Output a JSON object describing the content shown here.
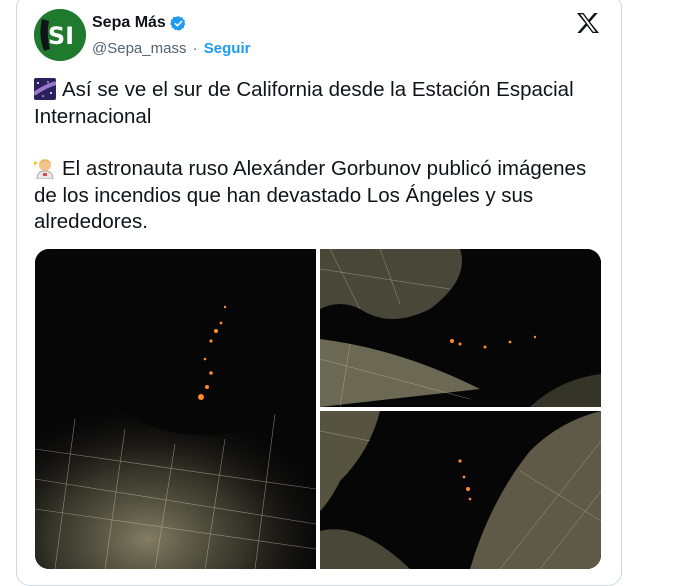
{
  "tweet": {
    "author_name": "Sepa Más",
    "handle": "@Sepa_mass",
    "separator": "·",
    "follow_label": "Seguir",
    "avatar_text": "SI",
    "paragraph1": "Así se ve el sur de California desde la Estación Espacial Internacional",
    "paragraph2": "El astronauta ruso Alexánder Gorbunov publicó imágenes de los incendios que han devastado Los Ángeles y sus alrededores.",
    "emoji1": "milky-way-icon",
    "emoji2": "astronaut-icon",
    "media_count": 3
  },
  "colors": {
    "link": "#1d9bf0",
    "verified": "#1d9bf0",
    "text": "#0f1419",
    "secondary": "#536471",
    "avatar_bg": "#1f7a2e",
    "border": "#cfd9de",
    "night_sky": "#060607",
    "city_lights": "#e8e2c8",
    "fire": "#ff8a2a"
  }
}
